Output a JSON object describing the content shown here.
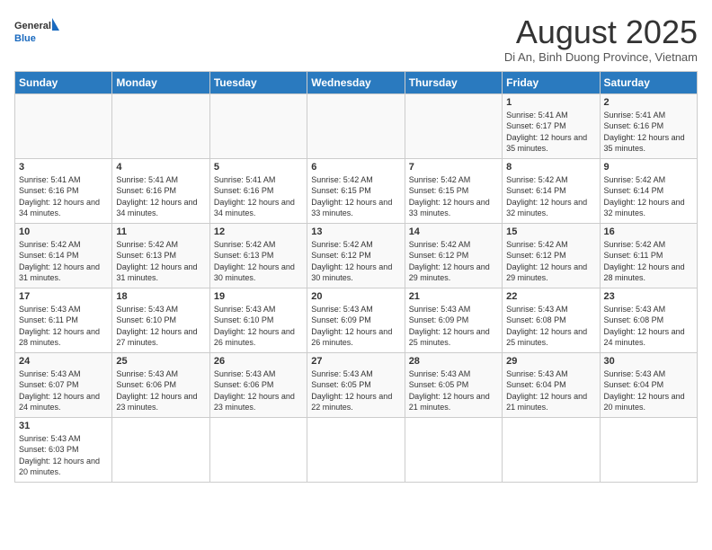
{
  "logo": {
    "text_general": "General",
    "text_blue": "Blue"
  },
  "header": {
    "title": "August 2025",
    "subtitle": "Di An, Binh Duong Province, Vietnam"
  },
  "weekdays": [
    "Sunday",
    "Monday",
    "Tuesday",
    "Wednesday",
    "Thursday",
    "Friday",
    "Saturday"
  ],
  "weeks": [
    [
      {
        "day": "",
        "info": ""
      },
      {
        "day": "",
        "info": ""
      },
      {
        "day": "",
        "info": ""
      },
      {
        "day": "",
        "info": ""
      },
      {
        "day": "",
        "info": ""
      },
      {
        "day": "1",
        "info": "Sunrise: 5:41 AM\nSunset: 6:17 PM\nDaylight: 12 hours\nand 35 minutes."
      },
      {
        "day": "2",
        "info": "Sunrise: 5:41 AM\nSunset: 6:16 PM\nDaylight: 12 hours\nand 35 minutes."
      }
    ],
    [
      {
        "day": "3",
        "info": "Sunrise: 5:41 AM\nSunset: 6:16 PM\nDaylight: 12 hours\nand 34 minutes."
      },
      {
        "day": "4",
        "info": "Sunrise: 5:41 AM\nSunset: 6:16 PM\nDaylight: 12 hours\nand 34 minutes."
      },
      {
        "day": "5",
        "info": "Sunrise: 5:41 AM\nSunset: 6:16 PM\nDaylight: 12 hours\nand 34 minutes."
      },
      {
        "day": "6",
        "info": "Sunrise: 5:42 AM\nSunset: 6:15 PM\nDaylight: 12 hours\nand 33 minutes."
      },
      {
        "day": "7",
        "info": "Sunrise: 5:42 AM\nSunset: 6:15 PM\nDaylight: 12 hours\nand 33 minutes."
      },
      {
        "day": "8",
        "info": "Sunrise: 5:42 AM\nSunset: 6:14 PM\nDaylight: 12 hours\nand 32 minutes."
      },
      {
        "day": "9",
        "info": "Sunrise: 5:42 AM\nSunset: 6:14 PM\nDaylight: 12 hours\nand 32 minutes."
      }
    ],
    [
      {
        "day": "10",
        "info": "Sunrise: 5:42 AM\nSunset: 6:14 PM\nDaylight: 12 hours\nand 31 minutes."
      },
      {
        "day": "11",
        "info": "Sunrise: 5:42 AM\nSunset: 6:13 PM\nDaylight: 12 hours\nand 31 minutes."
      },
      {
        "day": "12",
        "info": "Sunrise: 5:42 AM\nSunset: 6:13 PM\nDaylight: 12 hours\nand 30 minutes."
      },
      {
        "day": "13",
        "info": "Sunrise: 5:42 AM\nSunset: 6:12 PM\nDaylight: 12 hours\nand 30 minutes."
      },
      {
        "day": "14",
        "info": "Sunrise: 5:42 AM\nSunset: 6:12 PM\nDaylight: 12 hours\nand 29 minutes."
      },
      {
        "day": "15",
        "info": "Sunrise: 5:42 AM\nSunset: 6:12 PM\nDaylight: 12 hours\nand 29 minutes."
      },
      {
        "day": "16",
        "info": "Sunrise: 5:42 AM\nSunset: 6:11 PM\nDaylight: 12 hours\nand 28 minutes."
      }
    ],
    [
      {
        "day": "17",
        "info": "Sunrise: 5:43 AM\nSunset: 6:11 PM\nDaylight: 12 hours\nand 28 minutes."
      },
      {
        "day": "18",
        "info": "Sunrise: 5:43 AM\nSunset: 6:10 PM\nDaylight: 12 hours\nand 27 minutes."
      },
      {
        "day": "19",
        "info": "Sunrise: 5:43 AM\nSunset: 6:10 PM\nDaylight: 12 hours\nand 26 minutes."
      },
      {
        "day": "20",
        "info": "Sunrise: 5:43 AM\nSunset: 6:09 PM\nDaylight: 12 hours\nand 26 minutes."
      },
      {
        "day": "21",
        "info": "Sunrise: 5:43 AM\nSunset: 6:09 PM\nDaylight: 12 hours\nand 25 minutes."
      },
      {
        "day": "22",
        "info": "Sunrise: 5:43 AM\nSunset: 6:08 PM\nDaylight: 12 hours\nand 25 minutes."
      },
      {
        "day": "23",
        "info": "Sunrise: 5:43 AM\nSunset: 6:08 PM\nDaylight: 12 hours\nand 24 minutes."
      }
    ],
    [
      {
        "day": "24",
        "info": "Sunrise: 5:43 AM\nSunset: 6:07 PM\nDaylight: 12 hours\nand 24 minutes."
      },
      {
        "day": "25",
        "info": "Sunrise: 5:43 AM\nSunset: 6:06 PM\nDaylight: 12 hours\nand 23 minutes."
      },
      {
        "day": "26",
        "info": "Sunrise: 5:43 AM\nSunset: 6:06 PM\nDaylight: 12 hours\nand 23 minutes."
      },
      {
        "day": "27",
        "info": "Sunrise: 5:43 AM\nSunset: 6:05 PM\nDaylight: 12 hours\nand 22 minutes."
      },
      {
        "day": "28",
        "info": "Sunrise: 5:43 AM\nSunset: 6:05 PM\nDaylight: 12 hours\nand 21 minutes."
      },
      {
        "day": "29",
        "info": "Sunrise: 5:43 AM\nSunset: 6:04 PM\nDaylight: 12 hours\nand 21 minutes."
      },
      {
        "day": "30",
        "info": "Sunrise: 5:43 AM\nSunset: 6:04 PM\nDaylight: 12 hours\nand 20 minutes."
      }
    ],
    [
      {
        "day": "31",
        "info": "Sunrise: 5:43 AM\nSunset: 6:03 PM\nDaylight: 12 hours\nand 20 minutes."
      },
      {
        "day": "",
        "info": ""
      },
      {
        "day": "",
        "info": ""
      },
      {
        "day": "",
        "info": ""
      },
      {
        "day": "",
        "info": ""
      },
      {
        "day": "",
        "info": ""
      },
      {
        "day": "",
        "info": ""
      }
    ]
  ]
}
